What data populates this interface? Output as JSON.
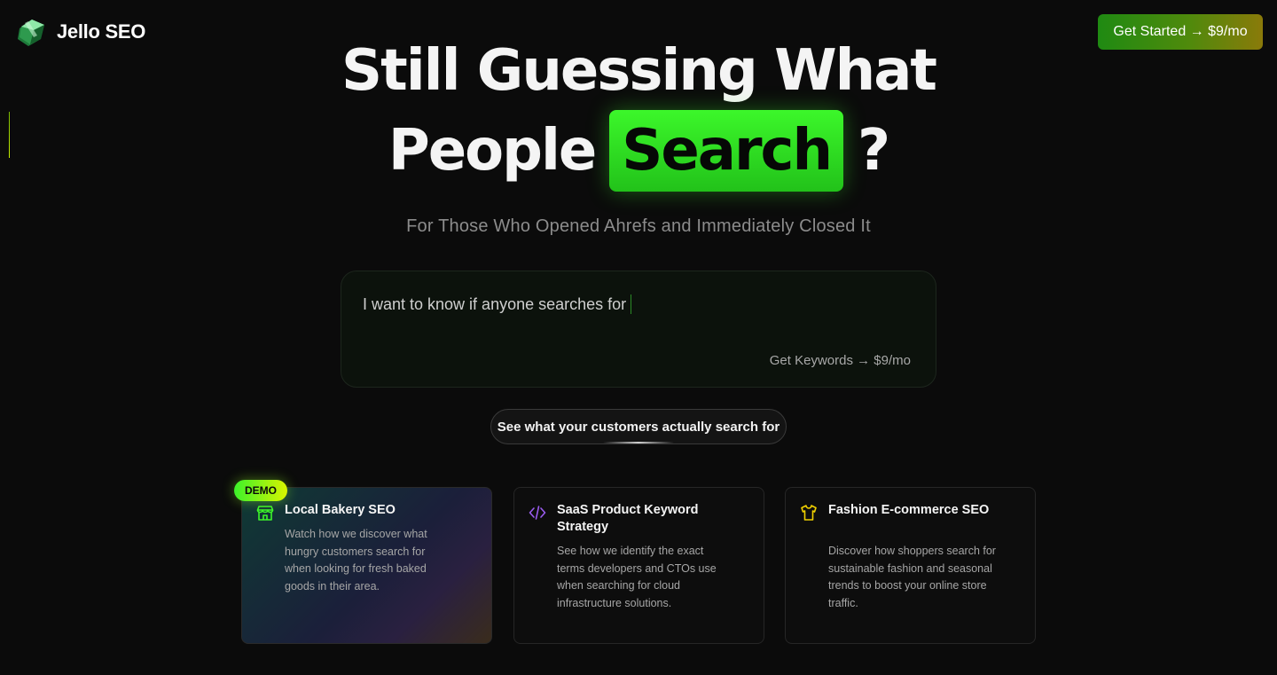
{
  "brand": {
    "name": "Jello SEO",
    "logo_icon": "jello-cube-icon"
  },
  "header": {
    "cta_label": "Get Started → $9/mo"
  },
  "hero": {
    "line1": "Still Guessing What",
    "line2_prefix": "People",
    "line2_highlight": "Search",
    "line2_suffix": "?",
    "subtitle": "For Those Who Opened Ahrefs and Immediately Closed It"
  },
  "search": {
    "typed_text": "I want to know if anyone searches for",
    "submit_label": "Get Keywords → $9/mo"
  },
  "examples_button": "See what your customers actually search for",
  "cards": [
    {
      "badge": "DEMO",
      "icon": "store-icon",
      "title": "Local Bakery SEO",
      "description": "Watch how we discover what hungry customers search for when looking for fresh baked goods in their area."
    },
    {
      "icon": "code-icon",
      "title": "SaaS Product Keyword Strategy",
      "description": "See how we identify the exact terms developers and CTOs use when searching for cloud infrastructure solutions."
    },
    {
      "icon": "shirt-icon",
      "title": "Fashion E-commerce SEO",
      "description": "Discover how shoppers search for sustainable fashion and seasonal trends to boost your online store traffic."
    }
  ],
  "colors": {
    "background": "#0b0b0b",
    "accent_green": "#3cf72a",
    "cta_gradient_start": "#1f8a12",
    "cta_gradient_end": "#8a7a0a",
    "code_icon": "#9a5cf0",
    "shirt_icon": "#f0d000",
    "store_icon": "#3cf72a"
  }
}
